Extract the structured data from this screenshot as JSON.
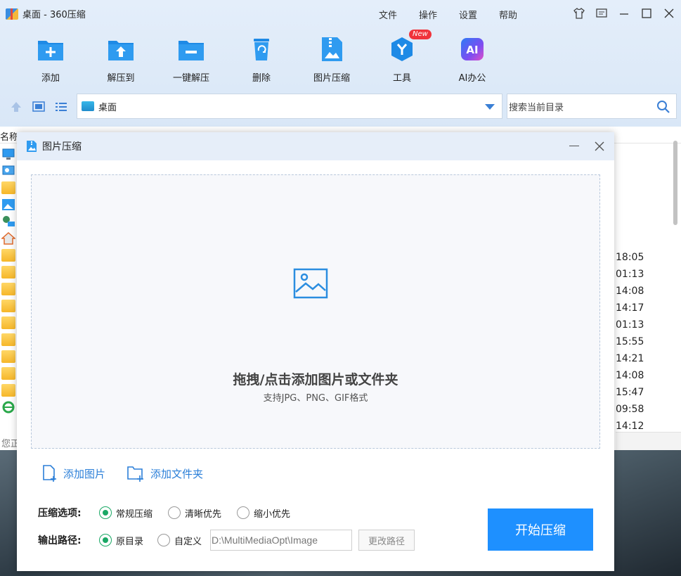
{
  "app": {
    "title": "桌面 - 360压缩"
  },
  "menu": [
    "文件",
    "操作",
    "设置",
    "帮助"
  ],
  "toolbar": [
    {
      "label": "添加",
      "icon": "add-icon"
    },
    {
      "label": "解压到",
      "icon": "extract-to-icon"
    },
    {
      "label": "一键解压",
      "icon": "one-click-extract-icon"
    },
    {
      "label": "删除",
      "icon": "recycle-bin-icon"
    },
    {
      "label": "图片压缩",
      "icon": "image-compress-icon"
    },
    {
      "label": "工具",
      "icon": "tools-icon",
      "badge": "New"
    },
    {
      "label": "AI办公",
      "icon": "ai-office-icon",
      "icon_text": "AI"
    }
  ],
  "nav": {
    "path": "桌面",
    "search_placeholder": "搜索当前目录"
  },
  "list": {
    "column_name": "名称",
    "times": [
      "18:05",
      "01:13",
      "14:08",
      "14:17",
      "01:13",
      "15:55",
      "14:21",
      "14:08",
      "15:47",
      "09:58",
      "14:12"
    ],
    "status": "您正"
  },
  "dialog": {
    "title": "图片压缩",
    "drop_title": "拖拽/点击添加图片或文件夹",
    "drop_subtitle": "支持JPG、PNG、GIF格式",
    "add_image": "添加图片",
    "add_folder": "添加文件夹",
    "compress_label": "压缩选项:",
    "compress_options": [
      {
        "label": "常规压缩",
        "selected": true
      },
      {
        "label": "清晰优先",
        "selected": false
      },
      {
        "label": "缩小优先",
        "selected": false
      }
    ],
    "output_label": "输出路径:",
    "output_options": [
      {
        "label": "原目录",
        "selected": true
      },
      {
        "label": "自定义",
        "selected": false
      }
    ],
    "output_path": "D:\\MultiMediaOpt\\Image",
    "change_path": "更改路径",
    "start": "开始压缩"
  },
  "colors": {
    "accent": "#1e90ff",
    "radio_on": "#1aa865",
    "link": "#2b7fd8"
  }
}
